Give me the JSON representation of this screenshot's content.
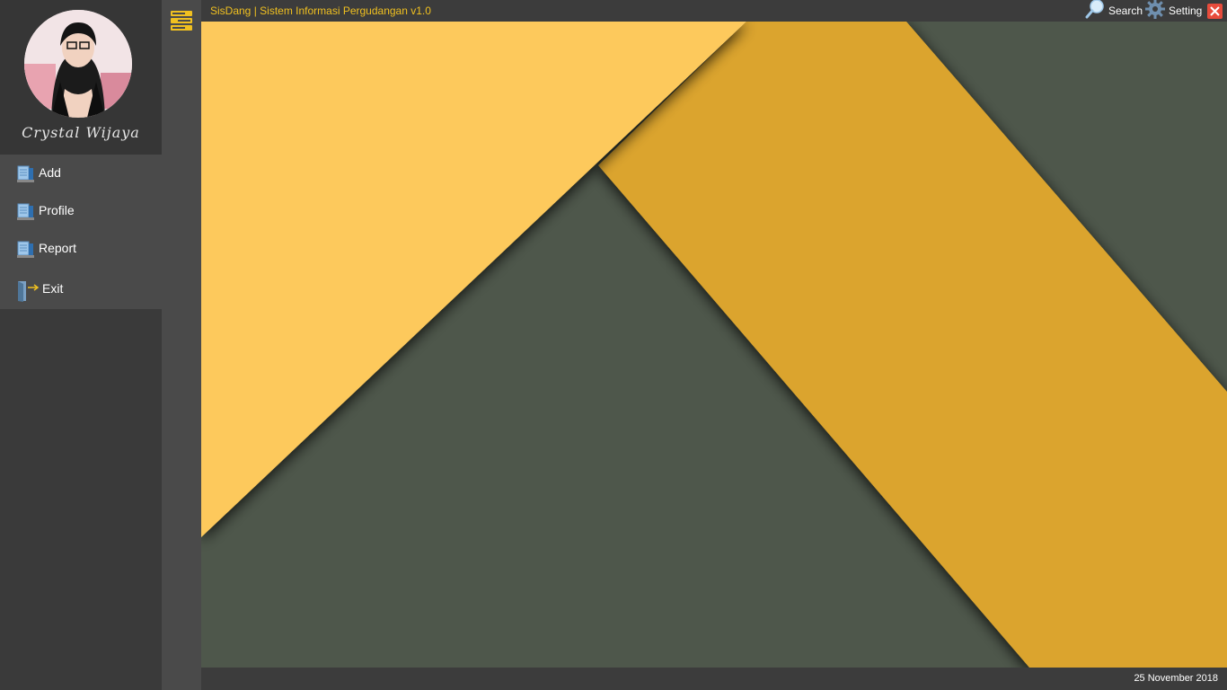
{
  "window": {
    "title": "SisDang | Sistem Informasi Pergudangan v1.0",
    "accent_color": "#f0c020",
    "close_color": "#e74c3c"
  },
  "user": {
    "name": "Crystal Wijaya"
  },
  "menu": {
    "items": [
      {
        "label": "Add",
        "icon": "add-document-icon"
      },
      {
        "label": "Profile",
        "icon": "profile-document-icon"
      },
      {
        "label": "Report",
        "icon": "report-document-icon"
      },
      {
        "label": "Exit",
        "icon": "exit-door-icon"
      }
    ]
  },
  "toolbar": {
    "search_label": "Search",
    "setting_label": "Setting"
  },
  "status": {
    "date": "25 November 2018"
  },
  "wallpaper": {
    "colors": [
      "#fdc95b",
      "#dba42f",
      "#4e574b"
    ]
  }
}
